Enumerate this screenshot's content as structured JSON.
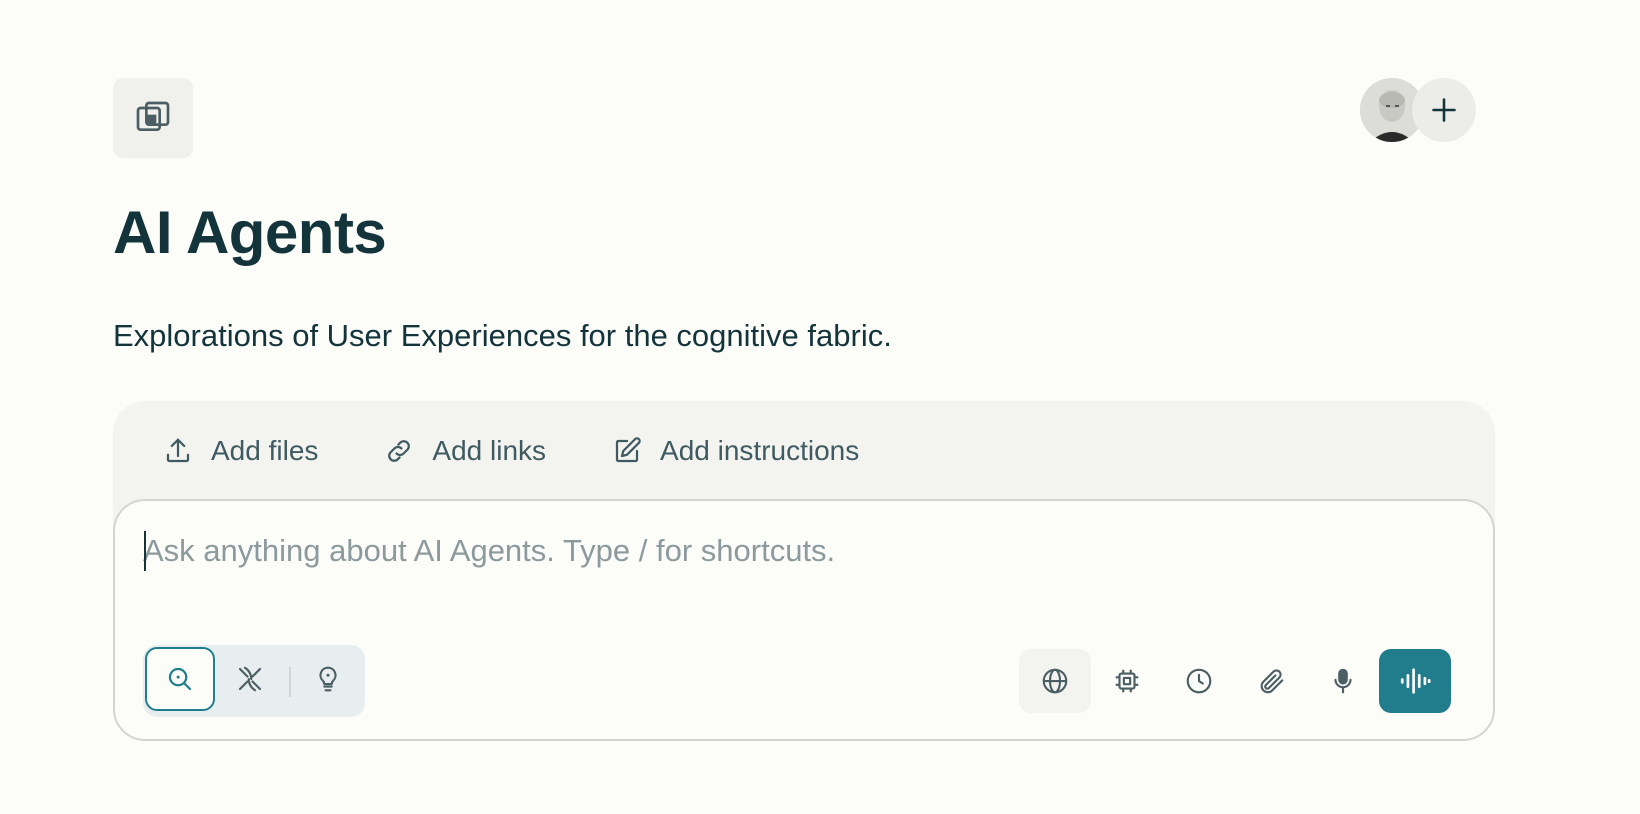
{
  "space": {
    "title": "AI Agents",
    "description": "Explorations of User Experiences for the cognitive fabric.",
    "icon": "space-icon"
  },
  "header": {
    "avatar_icon": "user-avatar",
    "add_icon": "plus-icon"
  },
  "sources": {
    "items": [
      {
        "label": "Add files",
        "icon": "upload-icon"
      },
      {
        "label": "Add links",
        "icon": "link-icon"
      },
      {
        "label": "Add instructions",
        "icon": "pencil-icon"
      }
    ]
  },
  "composer": {
    "placeholder": "Ask anything about AI Agents. Type / for shortcuts.",
    "value": "",
    "modes": [
      {
        "icon": "search-icon",
        "active": true
      },
      {
        "icon": "research-icon",
        "active": false
      },
      {
        "icon": "lightbulb-icon",
        "active": false
      }
    ],
    "tools": [
      "globe-icon",
      "cpu-icon",
      "clock-icon",
      "paperclip-icon",
      "microphone-icon"
    ],
    "voice_icon": "voice-waveform-icon",
    "accent_color": "#217d8b"
  }
}
